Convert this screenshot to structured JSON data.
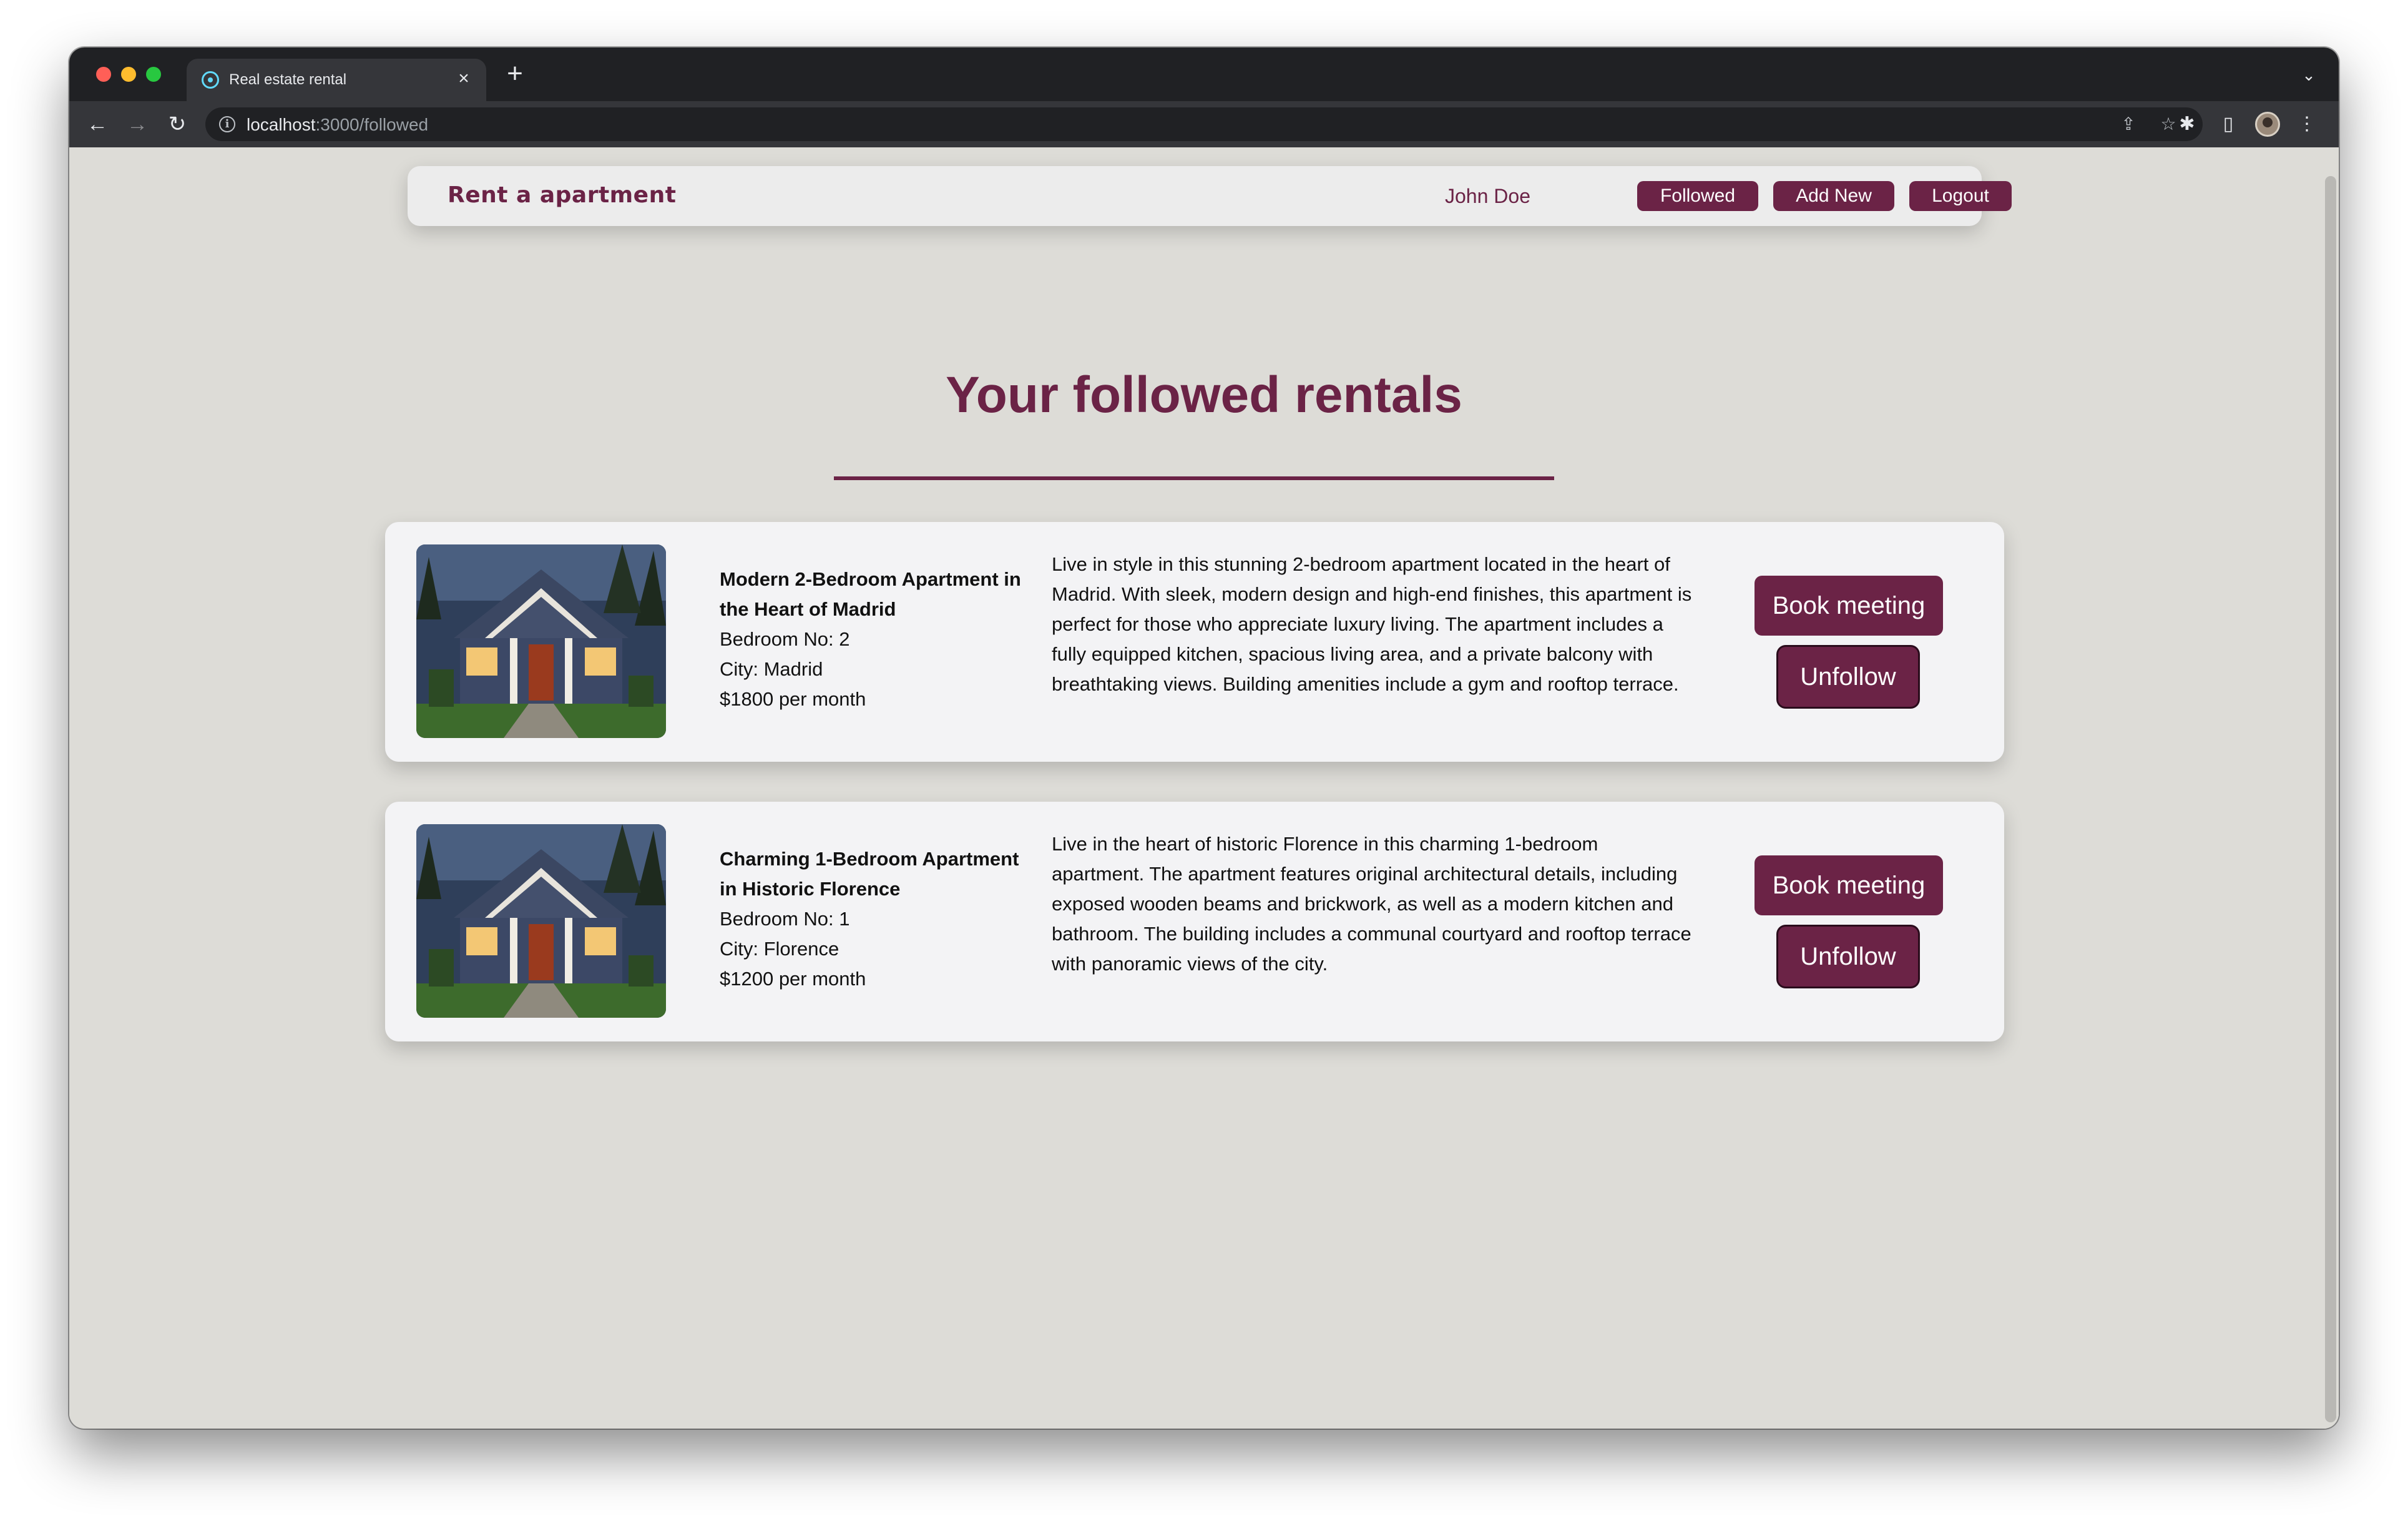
{
  "browser": {
    "tab_title": "Real estate rental",
    "tab_close": "×",
    "new_tab": "+",
    "tab_search_icon": "⌄",
    "url_host": "localhost",
    "url_path": ":3000/followed",
    "back_icon": "←",
    "forward_icon": "→",
    "reload_icon": "↻",
    "info_icon": "i",
    "share_icon": "⇪",
    "star_icon": "☆",
    "extensions_icon": "✱",
    "side_panel_icon": "▯",
    "menu_icon": "⋮"
  },
  "navbar": {
    "brand": "Rent a apartment",
    "user_name": "John Doe",
    "followed_label": "Followed",
    "add_new_label": "Add New",
    "logout_label": "Logout"
  },
  "main": {
    "title": "Your followed rentals"
  },
  "rentals": [
    {
      "title": "Modern 2-Bedroom Apartment in the Heart of Madrid",
      "bedrooms": "Bedroom No: 2",
      "city": "City: Madrid",
      "price": "$1800 per month",
      "description": "Live in style in this stunning 2-bedroom apartment located in the heart of Madrid. With sleek, modern design and high-end finishes, this apartment is perfect for those who appreciate luxury living. The apartment includes a fully equipped kitchen, spacious living area, and a private balcony with breathtaking views. Building amenities include a gym and rooftop terrace.",
      "book_label": "Book meeting",
      "unfollow_label": "Unfollow"
    },
    {
      "title": "Charming 1-Bedroom Apartment in Historic Florence",
      "bedrooms": "Bedroom No: 1",
      "city": "City: Florence",
      "price": "$1200 per month",
      "description": "Live in the heart of historic Florence in this charming 1-bedroom apartment. The apartment features original architectural details, including exposed wooden beams and brickwork, as well as a modern kitchen and bathroom. The building includes a communal courtyard and rooftop terrace with panoramic views of the city.",
      "book_label": "Book meeting",
      "unfollow_label": "Unfollow"
    }
  ],
  "colors": {
    "accent": "#6b2346",
    "page_background": "#dddcd7",
    "card_background": "#f3f3f5",
    "navbar_background": "#ececec"
  }
}
